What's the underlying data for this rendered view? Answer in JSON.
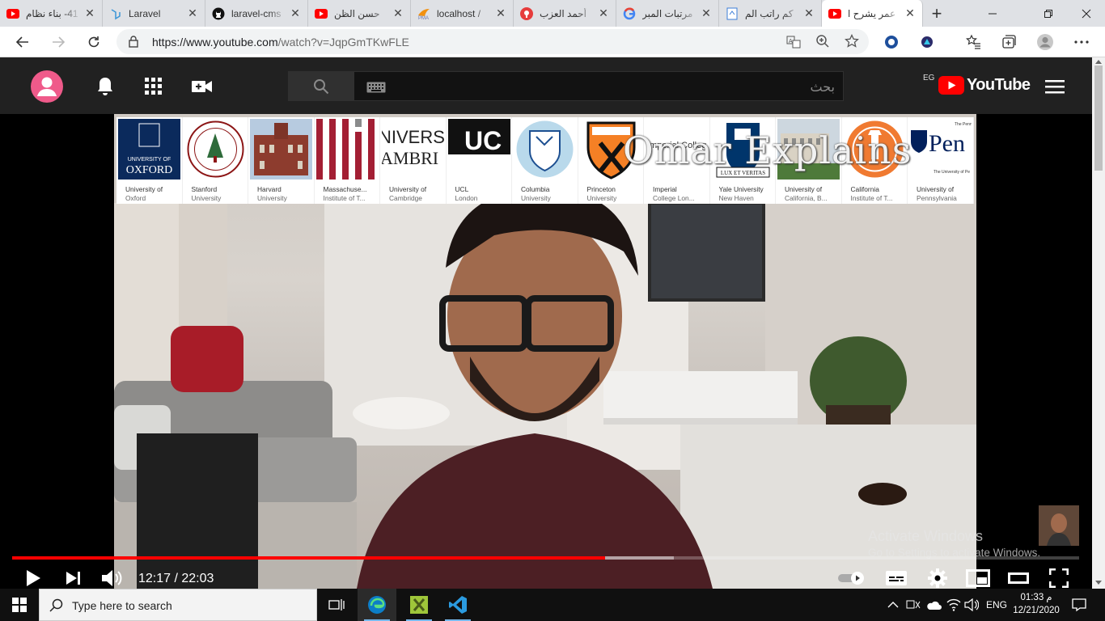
{
  "browser": {
    "tabs": [
      {
        "title": "41- بناء نظام",
        "favicon": "youtube-icon",
        "active": false
      },
      {
        "title": "Laravel",
        "favicon": "laravel-icon",
        "active": false
      },
      {
        "title": "laravel-cms",
        "favicon": "github-icon",
        "active": false
      },
      {
        "title": "حسن الظن",
        "favicon": "youtube-icon",
        "active": false
      },
      {
        "title": "localhost /",
        "favicon": "phpmyadmin-icon",
        "active": false
      },
      {
        "title": "أحمد العزب",
        "favicon": "podcast-icon",
        "active": false
      },
      {
        "title": "مرتبات المبر",
        "favicon": "google-icon",
        "active": false
      },
      {
        "title": "كم راتب الم",
        "favicon": "page-icon",
        "active": false
      },
      {
        "title": "عمر يشرح ا",
        "favicon": "youtube-icon",
        "active": true
      }
    ],
    "new_tab_label": "+",
    "url_host": "https://www.youtube.com",
    "url_path": "/watch?v=JqpGmTKwFLE"
  },
  "youtube": {
    "search_placeholder": "بحث",
    "logo_text": "YouTube",
    "region": "EG"
  },
  "video": {
    "universities": [
      {
        "line1": "University of",
        "line2": "Oxford"
      },
      {
        "line1": "Stanford",
        "line2": "University"
      },
      {
        "line1": "Harvard",
        "line2": "University"
      },
      {
        "line1": "Massachuse...",
        "line2": "Institute of T..."
      },
      {
        "line1": "University of",
        "line2": "Cambridge"
      },
      {
        "line1": "UCL",
        "line2": "London"
      },
      {
        "line1": "Columbia",
        "line2": "University"
      },
      {
        "line1": "Princeton",
        "line2": "University"
      },
      {
        "line1": "Imperial",
        "line2": "College Lon..."
      },
      {
        "line1": "Yale University",
        "line2": "New Haven"
      },
      {
        "line1": "University of",
        "line2": "California, B..."
      },
      {
        "line1": "California",
        "line2": "Institute of T..."
      },
      {
        "line1": "University of",
        "line2": "Pennsylvania"
      }
    ],
    "logo_texts": {
      "oxford_top": "UNIVERSITY OF",
      "oxford_main": "OXFORD",
      "cambridge": "NIVERSI AMBRI",
      "ucl": "UC",
      "imperial": "Imperial Colleg",
      "yale": "LUX ET VERITAS",
      "penn": "Pen",
      "penn_sub1": "The Penn M",
      "penn_sub2": "The University of Pe"
    },
    "watermark": "Omar Explains",
    "activate_title": "Activate Windows",
    "activate_sub": "Go to Settings to activate Windows.",
    "time_current": "12:17",
    "time_total": "22:03",
    "time_display": "12:17 / 22:03",
    "played_fraction": 0.556,
    "loaded_fraction": 0.62,
    "progress_color": "#ff0000"
  },
  "taskbar": {
    "search_placeholder": "Type here to search",
    "language": "ENG",
    "time": "01:33 م",
    "date": "12/21/2020"
  }
}
